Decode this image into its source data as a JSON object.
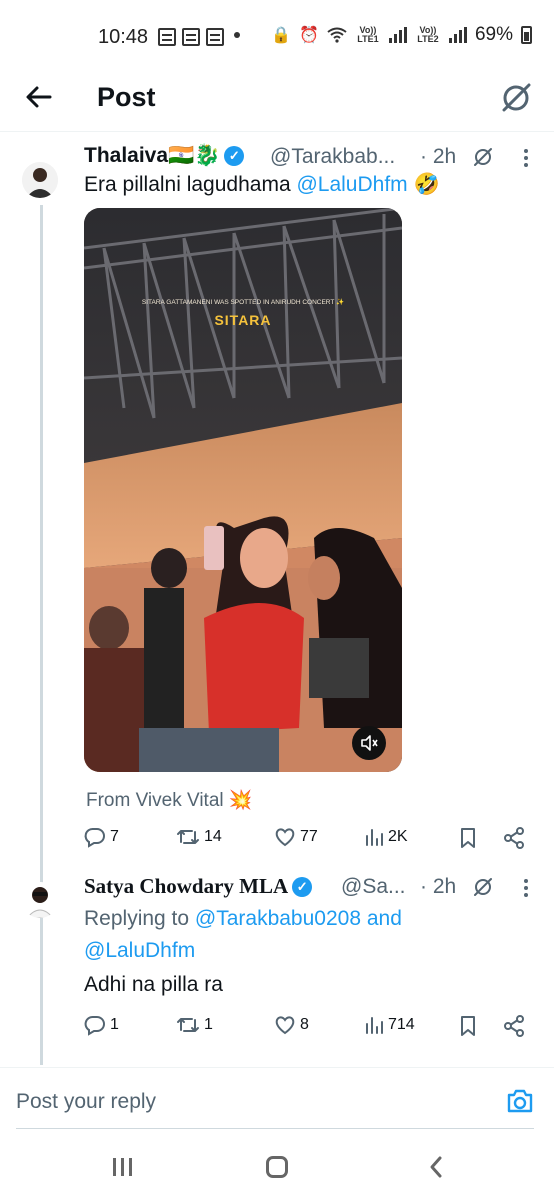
{
  "status_bar": {
    "time": "10:48",
    "lte1": "Vo)) LTE1",
    "lte2": "Vo)) LTE2",
    "battery": "69%"
  },
  "header": {
    "title": "Post"
  },
  "tweet": {
    "name": "Thalaiva🇮🇳🐉",
    "handle": "@Tarakbab...",
    "time": "· 2h",
    "text_before": "Era pillalni lagudhama ",
    "mention": "@LaluDhfm",
    "text_after": " 🤣",
    "video_caption": "SITARA GATTAMANENI WAS SPOTTED IN ANIRUDH CONCERT ✨",
    "video_title": "SITARA",
    "from_label": "From Vivek Vital 💥",
    "stats": {
      "replies": "7",
      "retweets": "14",
      "likes": "77",
      "views": "2K"
    }
  },
  "reply": {
    "name": "Satya Chowdary MLA",
    "handle": "@Sa...",
    "time": "· 2h",
    "replying_prefix": "Replying to ",
    "replying_user1": "@Tarakbabu0208",
    "replying_and": " and",
    "replying_user2": "@LaluDhfm",
    "text": "Adhi na pilla ra",
    "stats": {
      "replies": "1",
      "retweets": "1",
      "likes": "8",
      "views": "714"
    }
  },
  "composer": {
    "placeholder": "Post your reply"
  },
  "colors": {
    "accent": "#1d9bf0",
    "secondary_text": "#536471"
  }
}
